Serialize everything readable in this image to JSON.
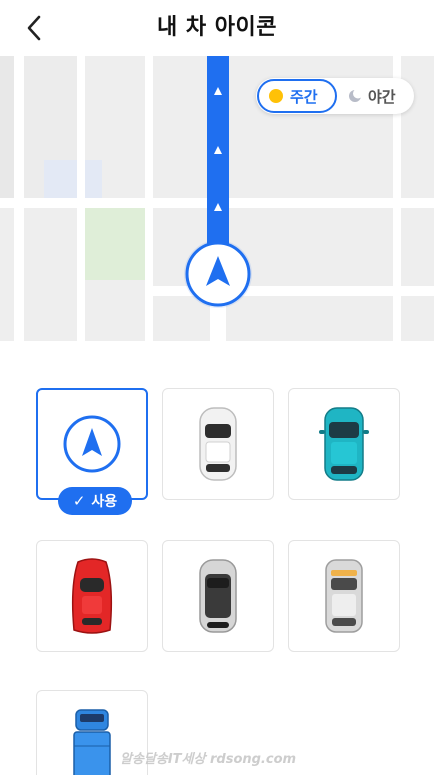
{
  "header": {
    "title": "내 차 아이콘",
    "back_icon": "chevron-left-icon"
  },
  "mode_toggle": {
    "day_label": "주간",
    "night_label": "야간",
    "selected": "day",
    "day_icon": "sun-icon",
    "night_icon": "moon-icon"
  },
  "icons": [
    {
      "name": "navigation-arrow",
      "selected": true,
      "badge": "사용",
      "color": "#1f6ff0"
    },
    {
      "name": "white-car",
      "selected": false,
      "color": "#f2f2f2"
    },
    {
      "name": "teal-car",
      "selected": false,
      "color": "#1fb5c4"
    },
    {
      "name": "red-car",
      "selected": false,
      "color": "#e32727"
    },
    {
      "name": "black-car",
      "selected": false,
      "color": "#3a3a3a"
    },
    {
      "name": "silver-car",
      "selected": false,
      "color": "#d9d9d9"
    },
    {
      "name": "blue-truck",
      "selected": false,
      "color": "#2f86e0"
    }
  ],
  "watermark": "알송달송IT세상 rdsong.com",
  "colors": {
    "accent": "#1f6ff0",
    "route": "#1f6ff0",
    "map_bg": "#eeeeee"
  }
}
